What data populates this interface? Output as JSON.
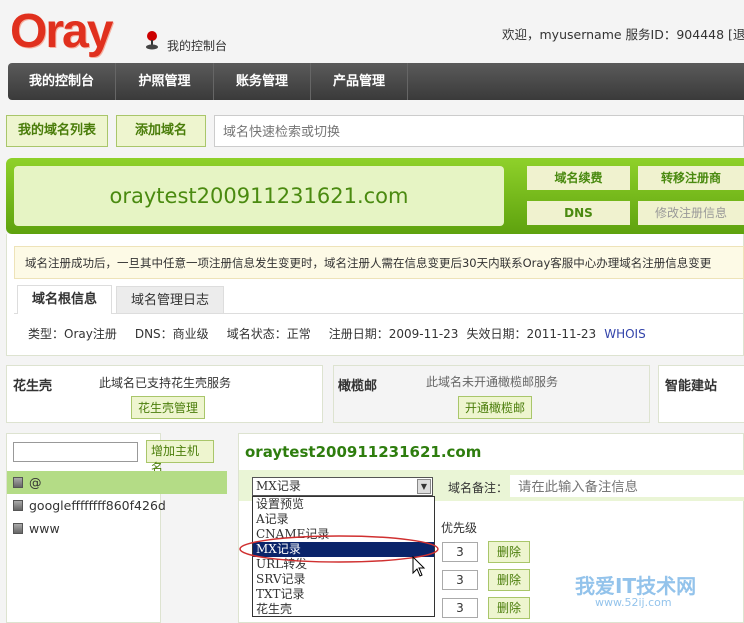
{
  "header": {
    "logo": "Oray",
    "console": "我的控制台",
    "welcome": "欢迎，myusername 服务ID：904448 [退"
  },
  "nav": [
    "我的控制台",
    "护照管理",
    "账务管理",
    "产品管理"
  ],
  "toolbar": {
    "my_domains": "我的域名列表",
    "add_domain": "添加域名",
    "search_placeholder": "域名快速检索或切换"
  },
  "domain": {
    "name": "oraytest200911231621.com",
    "buttons": [
      "域名续费",
      "转移注册商",
      "DNS",
      "修改注册信息"
    ]
  },
  "notice": "域名注册成功后，一旦其中任意一项注册信息发生变更时，域名注册人需在信息变更后30天内联系Oray客服中心办理域名注册信息变更",
  "tabs": [
    "域名根信息",
    "域名管理日志"
  ],
  "info": {
    "type": "类型：Oray注册",
    "dns": "DNS：商业级",
    "status": "域名状态：正常",
    "reg": "注册日期：2009-11-23",
    "exp": "失效日期：2011-11-23",
    "whois": "WHOIS"
  },
  "services": [
    {
      "name": "花生壳",
      "desc": "此域名已支持花生壳服务",
      "button": "花生壳管理"
    },
    {
      "name": "橄榄邮",
      "desc": "此域名未开通橄榄邮服务",
      "button": "开通橄榄邮"
    },
    {
      "name": "智能建站"
    }
  ],
  "hosts": {
    "add_button": "增加主机名",
    "input_value": "",
    "items": [
      "@",
      "googleffffffff860f426d",
      "www"
    ]
  },
  "records": {
    "title": "oraytest200911231621.com",
    "select_value": "MX记录",
    "note_label": "域名备注：",
    "note_placeholder": "请在此输入备注信息",
    "options": [
      "设置预览",
      "A记录",
      "CNAME记录",
      "MX记录",
      "URL转发",
      "SRV记录",
      "TXT记录",
      "花生壳"
    ],
    "priority_label": "优先级",
    "priorities": [
      "3",
      "3",
      "3"
    ],
    "delete": "删除"
  },
  "watermark": {
    "text": "我爱IT技术网",
    "url": "www.52ij.com"
  },
  "colors": {
    "green": "#6cb515",
    "nav": "#444444",
    "selected": "#0a246a"
  }
}
